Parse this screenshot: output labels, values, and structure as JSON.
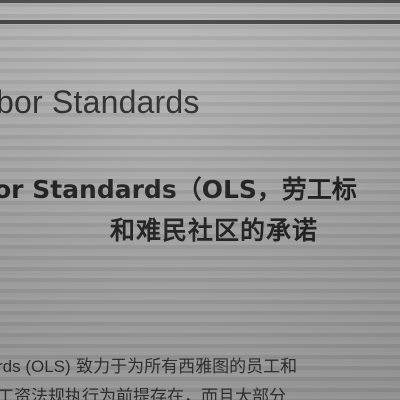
{
  "header": {
    "title": "abor Standards"
  },
  "heading": {
    "line1": "or Standards（OLS，劳工标",
    "line2": "和难民社区的承诺"
  },
  "body": {
    "line1_prefix": "rds (OLS)",
    "line1_rest": " 致力于为所有西雅图的员工和",
    "line2": "工资法规执行为前提存在，而且大部分"
  }
}
